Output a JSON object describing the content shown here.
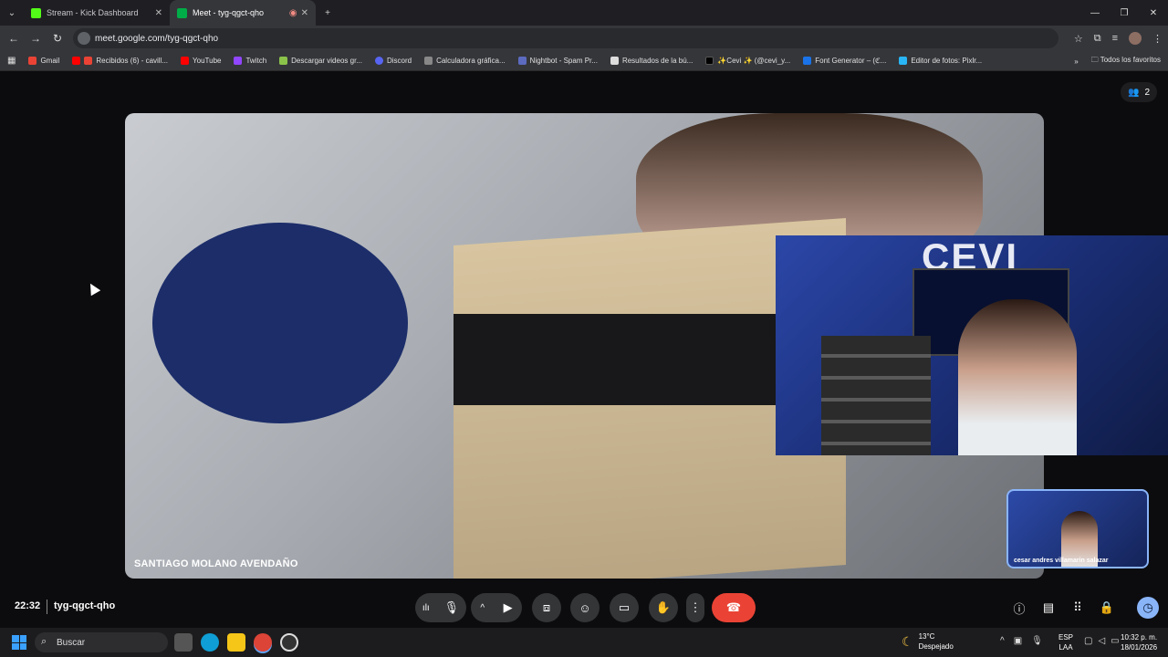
{
  "browser": {
    "tabs": [
      {
        "label": "Stream - Kick Dashboard",
        "icon": "kick-icon",
        "color": "#53fc18",
        "active": false
      },
      {
        "label": "Meet - tyg-qgct-qho",
        "icon": "meet-icon",
        "color": "#00ac47",
        "active": true
      }
    ],
    "url": "meet.google.com/tyg-qgct-qho",
    "bookmarks": [
      {
        "label": "Gmail",
        "color": "#ea4335"
      },
      {
        "label": "Recibidos (6) - cavill...",
        "color": "#ea4335"
      },
      {
        "label": "YouTube",
        "color": "#ff0000"
      },
      {
        "label": "Twitch",
        "color": "#9146ff"
      },
      {
        "label": "Descargar videos gr...",
        "color": "#8bc34a"
      },
      {
        "label": "Discord",
        "color": "#5865f2"
      },
      {
        "label": "Calculadora gráfica...",
        "color": "#888888"
      },
      {
        "label": "Nightbot - Spam Pr...",
        "color": "#5c6bc0"
      },
      {
        "label": "Resultados de la bú...",
        "color": "#dddddd"
      },
      {
        "label": "✨Cevi ✨ (@cevi_y...",
        "color": "#000000"
      },
      {
        "label": "Font Generator – (ℭ...",
        "color": "#1a73e8"
      },
      {
        "label": "Editor de fotos: Pixlr...",
        "color": "#29b6f6"
      }
    ],
    "all_favorites": "Todos los favoritos"
  },
  "meet": {
    "participant_count": "2",
    "main_speaker": "SANTIAGO MOLANO AVENDAÑO",
    "self_name": "cesar andres villamarin salazar",
    "pip_logo": "CEVI",
    "time": "22:32",
    "meeting_code": "tyg-qgct-qho"
  },
  "taskbar": {
    "search_placeholder": "Buscar",
    "weather_temp": "13°C",
    "weather_desc": "Despejado",
    "lang_top": "ESP",
    "lang_bottom": "LAA",
    "time": "10:32 p. m.",
    "date": "18/01/2026"
  }
}
